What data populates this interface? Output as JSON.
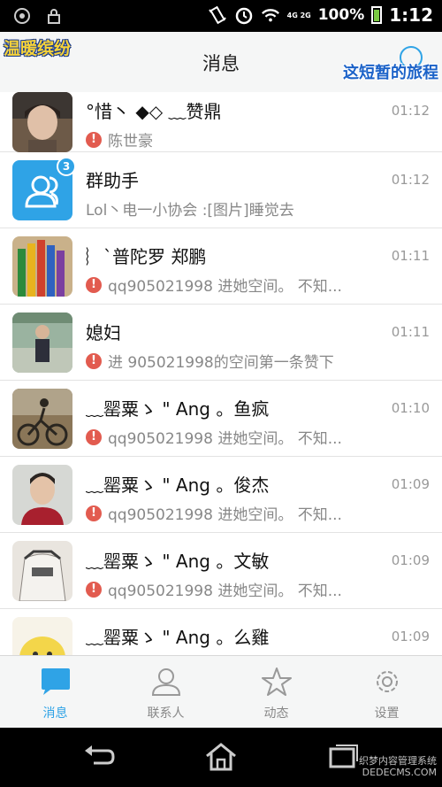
{
  "status": {
    "network": "4G 2G",
    "battery_percent": "100%",
    "time": "1:12"
  },
  "header": {
    "title": "消息",
    "watermark_left": "温暖缤纷",
    "watermark_right": "这短暂的旅程"
  },
  "conversations": [
    {
      "name": "°惜丶 ◆◇ ﹏赞鼎",
      "time": "01:12",
      "preview": "陈世豪",
      "warn": true,
      "avatar": "photo"
    },
    {
      "name": "群助手",
      "time": "01:12",
      "preview": "Lol丶电一小协会 :[图片]睡觉去",
      "warn": false,
      "avatar": "group-assistant",
      "badge": "3"
    },
    {
      "name": "︴`普陀罗 郑鹏",
      "time": "01:11",
      "preview": "qq905021998 进她空间。  不知...",
      "warn": true,
      "avatar": "pencils"
    },
    {
      "name": "媳妇",
      "time": "01:11",
      "preview": "进 905021998的空间第一条赞下",
      "warn": true,
      "avatar": "photo2"
    },
    {
      "name": "﹏罂粟ゝ \" Ang 。鱼疯",
      "time": "01:10",
      "preview": "qq905021998 进她空间。  不知...",
      "warn": true,
      "avatar": "bike"
    },
    {
      "name": "﹏罂粟ゝ \" Ang 。俊杰",
      "time": "01:09",
      "preview": "qq905021998 进她空间。  不知...",
      "warn": true,
      "avatar": "man"
    },
    {
      "name": "﹏罂粟ゝ \" Ang 。文敏",
      "time": "01:09",
      "preview": "qq905021998 进她空间。  不知...",
      "warn": true,
      "avatar": "shirt"
    },
    {
      "name": "﹏罂粟ゝ \" Ang 。么雞",
      "time": "01:09",
      "preview": "",
      "warn": false,
      "avatar": "chick"
    }
  ],
  "tabs": [
    {
      "label": "消息",
      "active": true
    },
    {
      "label": "联系人",
      "active": false
    },
    {
      "label": "动态",
      "active": false
    },
    {
      "label": "设置",
      "active": false
    }
  ],
  "watermark_bottom": {
    "line1": "织梦内容管理系统",
    "line2": "DEDECMS.COM"
  },
  "colors": {
    "accent": "#2fa3e6",
    "warn": "#e25b4f",
    "time": "#999999"
  }
}
